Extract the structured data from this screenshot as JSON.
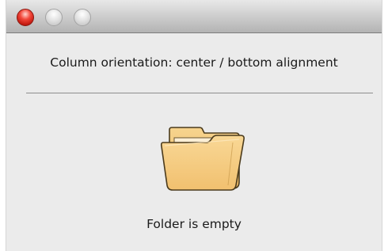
{
  "window": {
    "title_bar_buttons": [
      "close",
      "minimize",
      "zoom"
    ]
  },
  "main": {
    "heading": "Column orientation: center / bottom alignment",
    "folder_icon": "folder-icon",
    "empty_message": "Folder is empty"
  },
  "colors": {
    "folder_fill": "#f6c978",
    "folder_outline": "#4a3a1c",
    "close_button": "#e0342a"
  }
}
